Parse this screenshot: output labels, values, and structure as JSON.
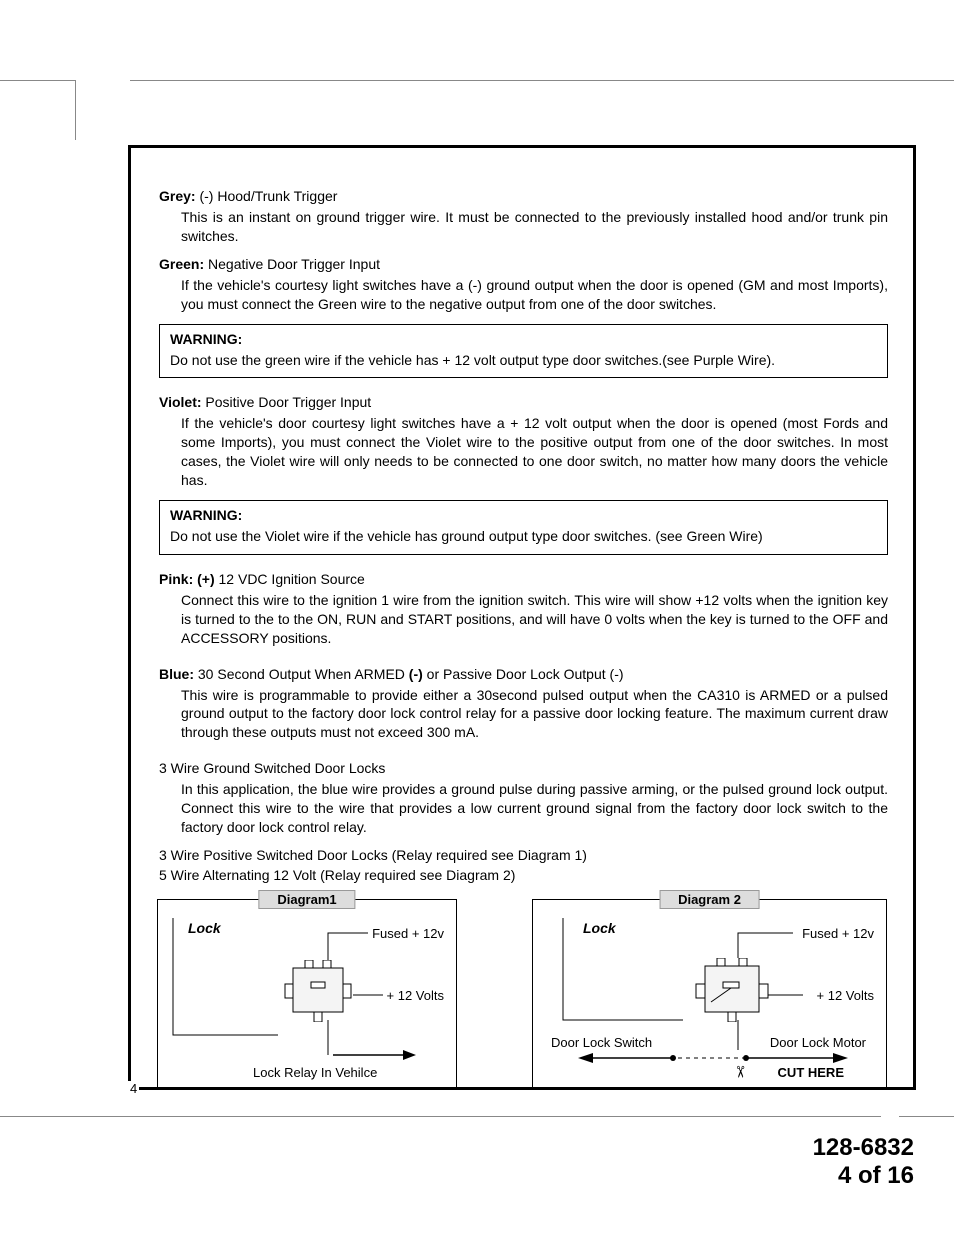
{
  "wires": {
    "grey": {
      "label": "Grey:",
      "title": " (-) Hood/Trunk Trigger",
      "text": "This is an instant on ground trigger wire. It must be connected to the previously installed hood and/or trunk pin switches."
    },
    "green": {
      "label": "Green:",
      "title": " Negative Door Trigger Input",
      "text": "If the vehicle's courtesy light switches have a (-) ground output when the door is opened (GM and most Imports), you must connect the Green wire to the negative output from one of the door switches."
    },
    "violet": {
      "label": "Violet:",
      "title": " Positive Door Trigger Input",
      "text": "If the vehicle's door courtesy light switches have a + 12 volt output when the door is opened (most Fords and some Imports), you must connect the Violet wire to the positive output from one of the door switches. In most cases, the Violet wire will only needs to be connected to one door switch, no matter how many doors the vehicle has."
    },
    "pink": {
      "label": "Pink: (+)",
      "title": " 12 VDC Ignition Source",
      "text": "Connect this wire to the ignition 1 wire from the ignition switch.  This wire will show +12 volts when the ignition key is turned to the to the ON, RUN and START positions, and will have 0 volts when the key is turned to the OFF and ACCESSORY positions."
    },
    "blue": {
      "label": "Blue:",
      "title_a": " 30 Second Output When ARMED ",
      "neg": "(-)",
      "title_b": " or Passive Door Lock Output (-)",
      "text": "This wire is programmable to provide either a 30second pulsed output when the CA310 is ARMED or a pulsed ground output to the factory door lock control relay for a passive door locking feature. The maximum current draw through these outputs must not exceed 300 mA."
    }
  },
  "warnings": {
    "w1": {
      "head": "WARNING:",
      "text": "Do not use the green wire if the vehicle has + 12 volt output type door switches.(see Purple Wire)."
    },
    "w2": {
      "head": "WARNING:",
      "text": "Do not use the Violet wire if the vehicle has ground output type door switches. (see Green Wire)"
    }
  },
  "doorlocks": {
    "h": "3 Wire Ground Switched Door Locks",
    "p": "In this application, the blue wire provides a ground pulse during passive arming, or the pulsed ground lock output. Connect this wire to the wire that provides a low current ground signal from the factory door lock switch to the factory door lock control relay.",
    "l1": "3 Wire Positive Switched Door Locks (Relay required see Diagram 1)",
    "l2": "5 Wire Alternating 12 Volt (Relay required see Diagram  2)"
  },
  "diagram1": {
    "title": "Diagram1",
    "lock": "Lock",
    "fused": "Fused + 12v",
    "v12": "+ 12 Volts",
    "bottom": "Lock Relay In Vehilce"
  },
  "diagram2": {
    "title": "Diagram 2",
    "lock": "Lock",
    "fused": "Fused + 12v",
    "v12": "+ 12 Volts",
    "switch": "Door Lock Switch",
    "motor": "Door Lock Motor",
    "cut": "CUT HERE"
  },
  "footer": {
    "code": "128-6832",
    "page": "4 of 16"
  },
  "inner_page": "4"
}
